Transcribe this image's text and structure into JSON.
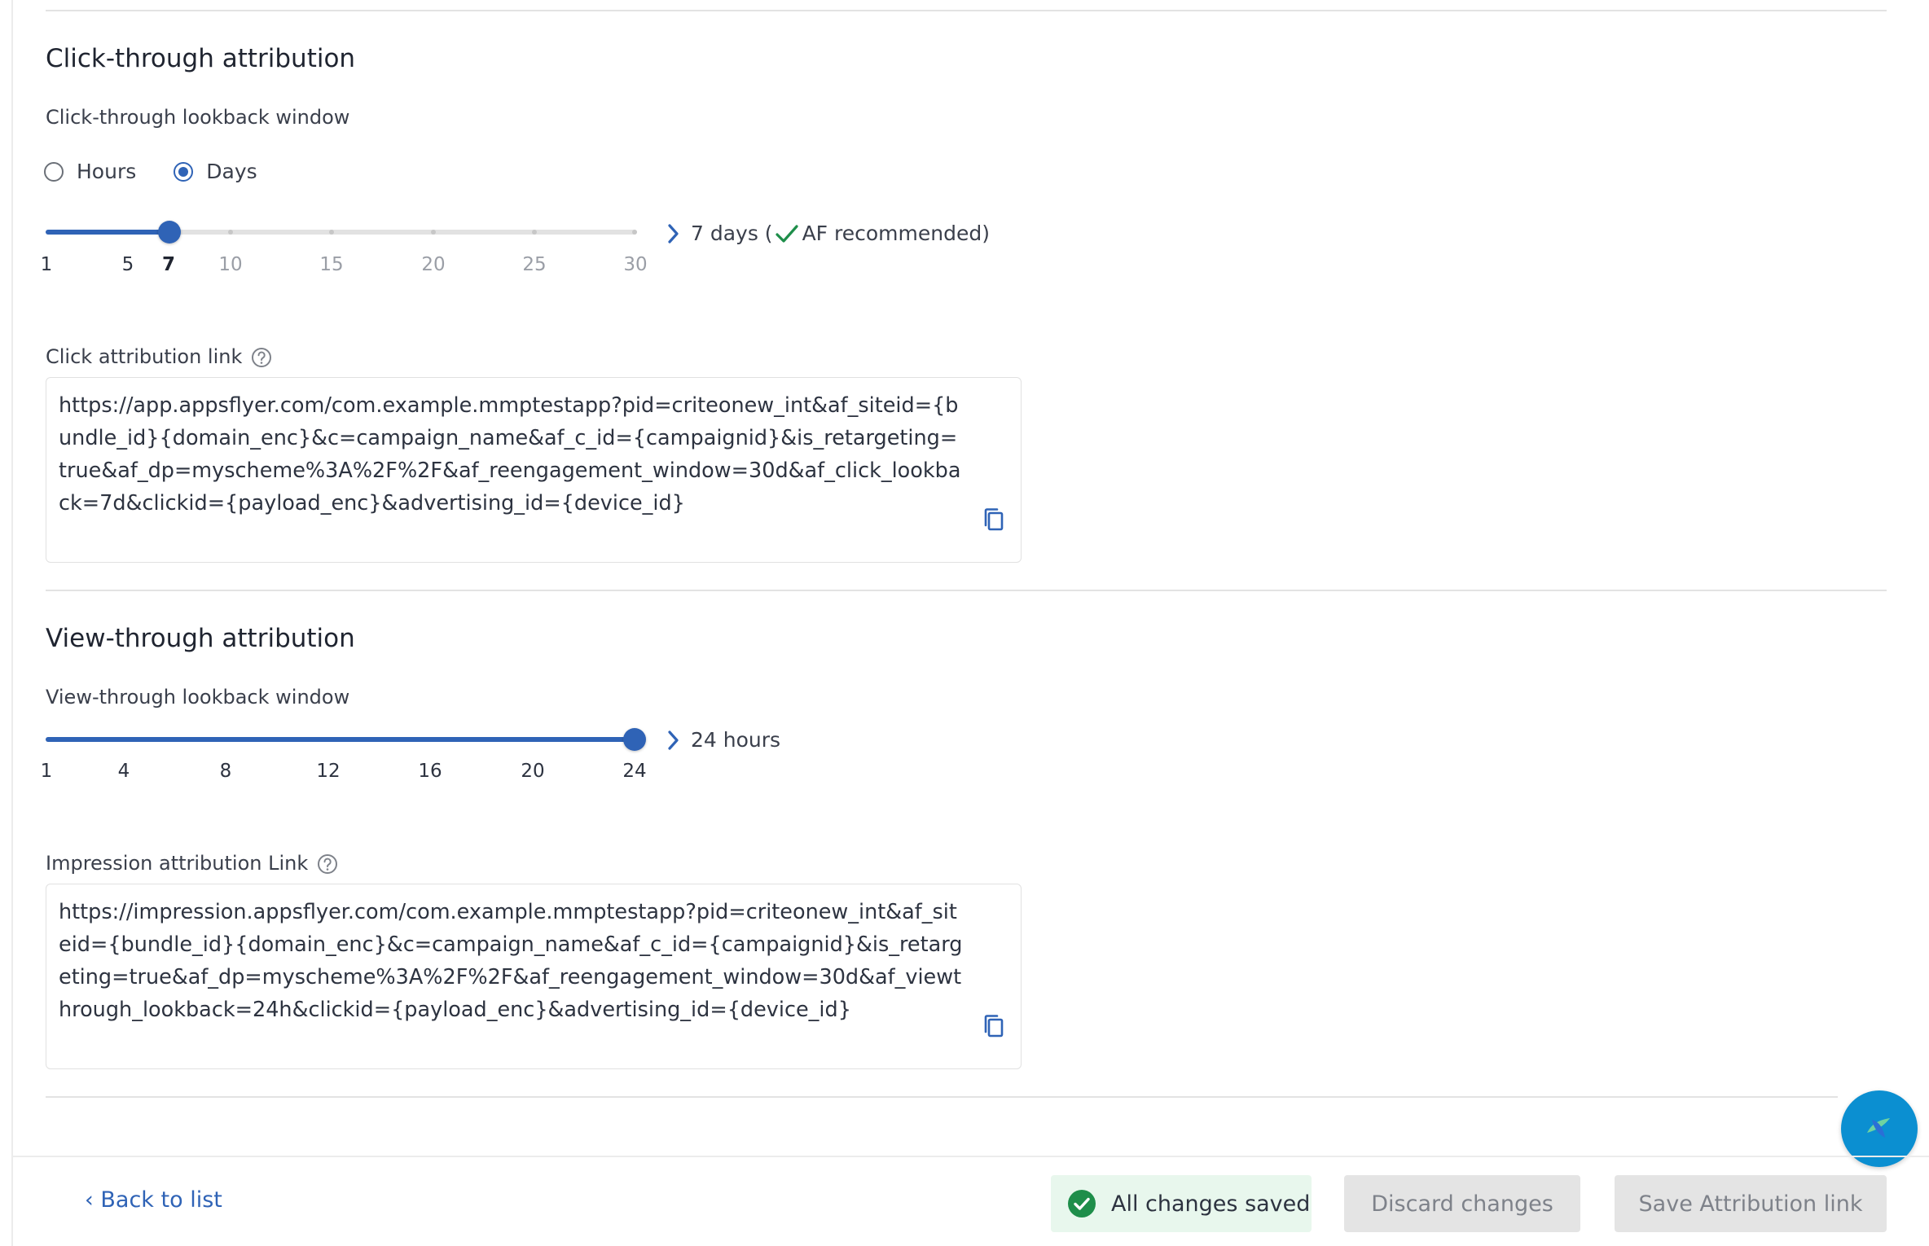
{
  "click_section": {
    "title": "Click-through attribution",
    "lookback_label": "Click-through lookback window",
    "radio_hours": "Hours",
    "radio_days": "Days",
    "selected_unit": "Days",
    "slider": {
      "min": 1,
      "max": 30,
      "value": 7,
      "ticks": [
        "1",
        "5",
        "7",
        "10",
        "15",
        "20",
        "25",
        "30"
      ]
    },
    "readout_prefix": "7 days (",
    "readout_suffix": "AF recommended)",
    "link_label": "Click attribution link",
    "link_value": "https://app.appsflyer.com/com.example.mmptestapp?pid=criteonew_int&af_siteid={bundle_id}{domain_enc}&c=campaign_name&af_c_id={campaignid}&is_retargeting=true&af_dp=myscheme%3A%2F%2F&af_reengagement_window=30d&af_click_lookback=7d&clickid={payload_enc}&advertising_id={device_id}"
  },
  "view_section": {
    "title": "View-through attribution",
    "lookback_label": "View-through lookback window",
    "slider": {
      "min": 1,
      "max": 24,
      "value": 24,
      "ticks": [
        "1",
        "4",
        "8",
        "12",
        "16",
        "20",
        "24"
      ]
    },
    "readout": "24 hours",
    "link_label": "Impression attribution Link",
    "link_value": "https://impression.appsflyer.com/com.example.mmptestapp?pid=criteonew_int&af_siteid={bundle_id}{domain_enc}&c=campaign_name&af_c_id={campaignid}&is_retargeting=true&af_dp=myscheme%3A%2F%2F&af_reengagement_window=30d&af_viewthrough_lookback=24h&clickid={payload_enc}&advertising_id={device_id}"
  },
  "footer": {
    "back_label": "‹ Back to list",
    "saved_status": "All changes saved",
    "discard_label": "Discard changes",
    "save_label": "Save Attribution link"
  },
  "colors": {
    "accent": "#2f63b6",
    "success": "#1e8e4a",
    "fab": "#0b8fd1"
  }
}
